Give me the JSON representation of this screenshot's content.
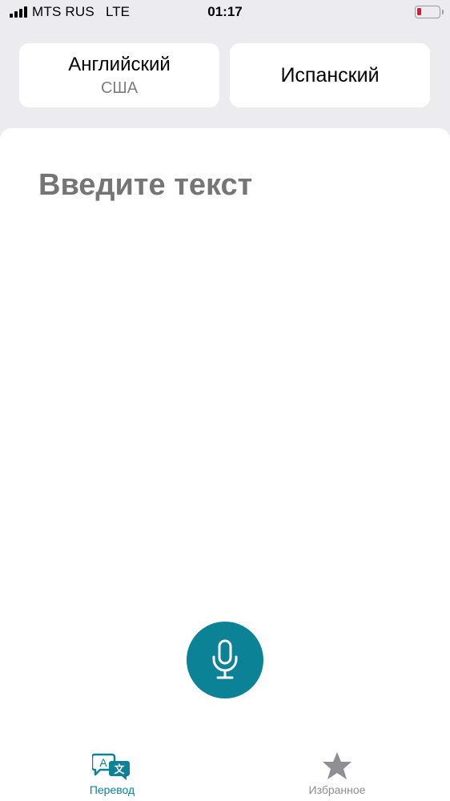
{
  "status_bar": {
    "carrier": "MTS RUS",
    "network": "LTE",
    "time": "01:17",
    "battery_level": 0.1,
    "battery_color": "#e0182b"
  },
  "language_selector": {
    "source_language": "Английский",
    "source_region": "США",
    "target_language": "Испанский"
  },
  "input": {
    "placeholder": "Введите текст",
    "value": ""
  },
  "mic": {
    "icon": "microphone-icon",
    "color": "#0c8296"
  },
  "tab_bar": {
    "tabs": [
      {
        "label": "Перевод",
        "icon": "translate-icon",
        "active": true
      },
      {
        "label": "Избранное",
        "icon": "star-icon",
        "active": false
      }
    ],
    "accent_color": "#0c8296",
    "inactive_color": "#8e8e93"
  }
}
